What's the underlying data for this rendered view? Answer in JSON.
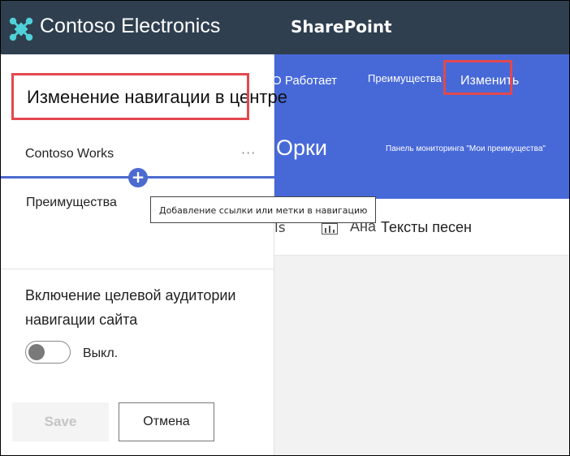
{
  "suite_bar": {
    "brand": "Contoso Electronics",
    "app": "SharePoint",
    "icon": "app-launcher-icon"
  },
  "site": {
    "nav": {
      "works": "O Работает",
      "benefits": "Преимущества",
      "edit": "Изменить"
    },
    "name": "Орки",
    "dashboard": "Панель мониторинга \"Мои преимущества\"",
    "command_bar": {
      "fragment1": "ls",
      "fragment2": "Ана",
      "lyrics": "Тексты песен"
    },
    "colors": {
      "header": "#4769d8",
      "suitebar": "#2f3f4f",
      "highlight": "#e2484e"
    }
  },
  "panel": {
    "title": "Изменение навигации в центре",
    "nav_items": [
      "Contoso Works",
      "Преимущества"
    ],
    "more_icon": "···",
    "add_icon": "+",
    "tooltip": "Добавление ссылки или метки в навигацию",
    "audience": {
      "label": "Включение целевой аудитории навигации сайта",
      "state": "Выкл."
    },
    "save_label": "Save",
    "cancel_label": "Отмена"
  }
}
